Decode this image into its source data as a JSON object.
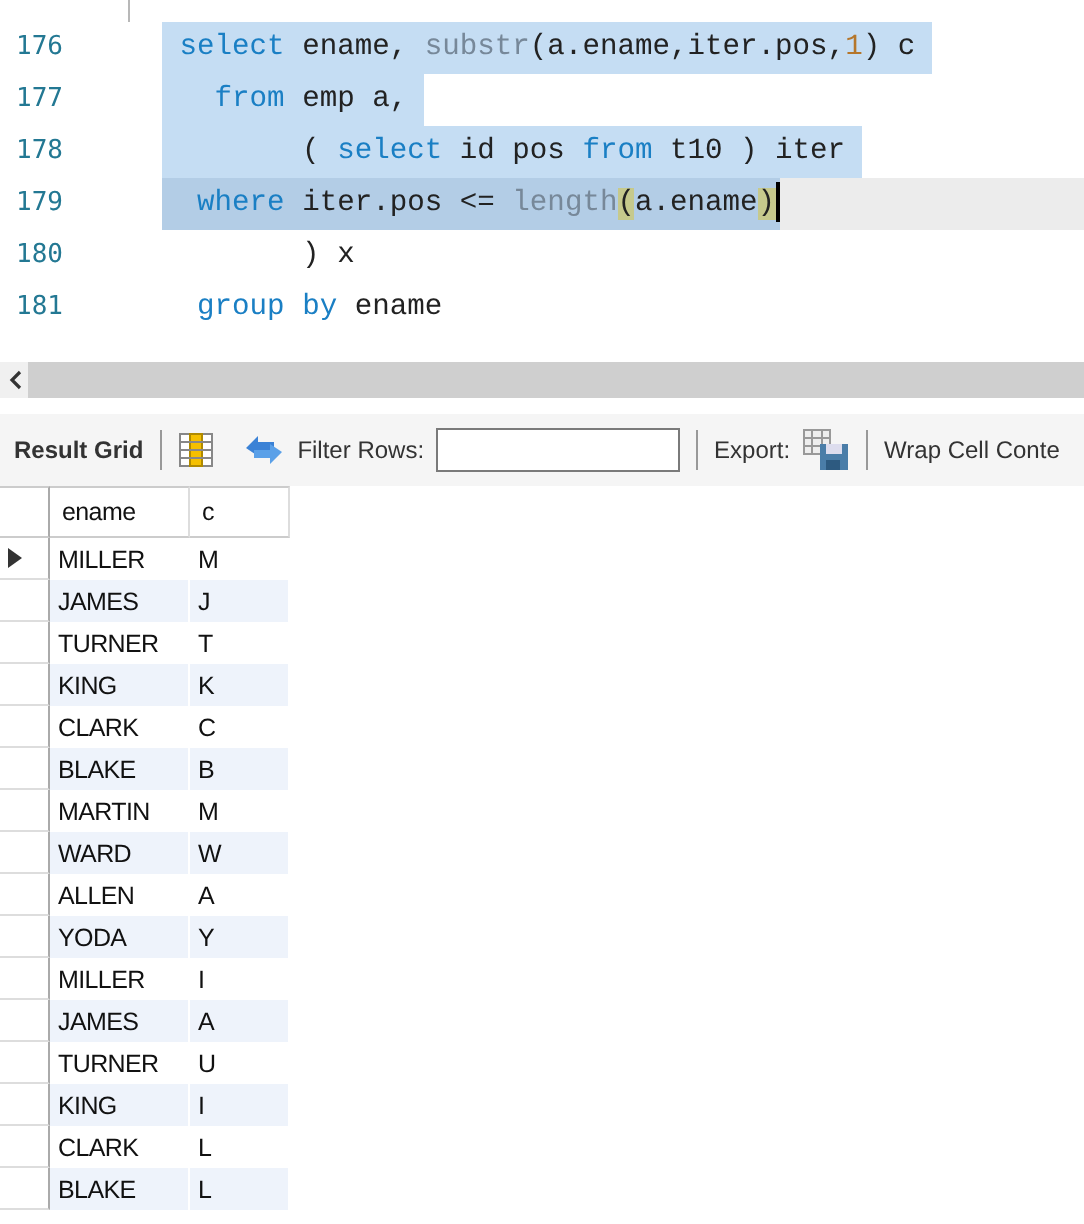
{
  "editor": {
    "lines": [
      {
        "number": "176",
        "selected": true,
        "current": false,
        "tokens": [
          {
            "text": " select",
            "kind": "keyword"
          },
          {
            "text": " ename, ",
            "kind": "plain"
          },
          {
            "text": "substr",
            "kind": "function"
          },
          {
            "text": "(a.ename,iter.pos,",
            "kind": "plain"
          },
          {
            "text": "1",
            "kind": "number"
          },
          {
            "text": ") c ",
            "kind": "plain"
          }
        ]
      },
      {
        "number": "177",
        "selected": true,
        "current": false,
        "tokens": [
          {
            "text": "   from",
            "kind": "keyword"
          },
          {
            "text": " emp a, ",
            "kind": "plain"
          }
        ]
      },
      {
        "number": "178",
        "selected": true,
        "current": false,
        "tokens": [
          {
            "text": "        ( ",
            "kind": "plain"
          },
          {
            "text": "select",
            "kind": "keyword"
          },
          {
            "text": " id pos ",
            "kind": "plain"
          },
          {
            "text": "from",
            "kind": "keyword"
          },
          {
            "text": " t10 ) iter ",
            "kind": "plain"
          }
        ]
      },
      {
        "number": "179",
        "selected": true,
        "current": true,
        "tokens": [
          {
            "text": "  where",
            "kind": "keyword"
          },
          {
            "text": " iter.pos <= ",
            "kind": "plain"
          },
          {
            "text": "length",
            "kind": "function"
          },
          {
            "text": "(",
            "kind": "bracket"
          },
          {
            "text": "a.ename",
            "kind": "plain"
          },
          {
            "text": ")",
            "kind": "bracket"
          }
        ]
      },
      {
        "number": "180",
        "selected": false,
        "current": false,
        "tokens": [
          {
            "text": "        ) x",
            "kind": "plain"
          }
        ]
      },
      {
        "number": "181",
        "selected": false,
        "current": false,
        "tokens": [
          {
            "text": "  group",
            "kind": "keyword"
          },
          {
            "text": " by",
            "kind": "keyword"
          },
          {
            "text": " ename",
            "kind": "plain"
          }
        ]
      }
    ]
  },
  "toolbar": {
    "title": "Result Grid",
    "filter_label": "Filter Rows:",
    "export_label": "Export:",
    "wrap_label": "Wrap Cell Conte"
  },
  "table": {
    "columns": [
      "ename",
      "c"
    ],
    "rows": [
      {
        "cells": [
          "MILLER",
          "M"
        ],
        "selected": true
      },
      {
        "cells": [
          "JAMES",
          "J"
        ],
        "selected": false
      },
      {
        "cells": [
          "TURNER",
          "T"
        ],
        "selected": false
      },
      {
        "cells": [
          "KING",
          "K"
        ],
        "selected": false
      },
      {
        "cells": [
          "CLARK",
          "C"
        ],
        "selected": false
      },
      {
        "cells": [
          "BLAKE",
          "B"
        ],
        "selected": false
      },
      {
        "cells": [
          "MARTIN",
          "M"
        ],
        "selected": false
      },
      {
        "cells": [
          "WARD",
          "W"
        ],
        "selected": false
      },
      {
        "cells": [
          "ALLEN",
          "A"
        ],
        "selected": false
      },
      {
        "cells": [
          "YODA",
          "Y"
        ],
        "selected": false
      },
      {
        "cells": [
          "MILLER",
          "I"
        ],
        "selected": false
      },
      {
        "cells": [
          "JAMES",
          "A"
        ],
        "selected": false
      },
      {
        "cells": [
          "TURNER",
          "U"
        ],
        "selected": false
      },
      {
        "cells": [
          "KING",
          "I"
        ],
        "selected": false
      },
      {
        "cells": [
          "CLARK",
          "L"
        ],
        "selected": false
      },
      {
        "cells": [
          "BLAKE",
          "L"
        ],
        "selected": false
      }
    ]
  }
}
